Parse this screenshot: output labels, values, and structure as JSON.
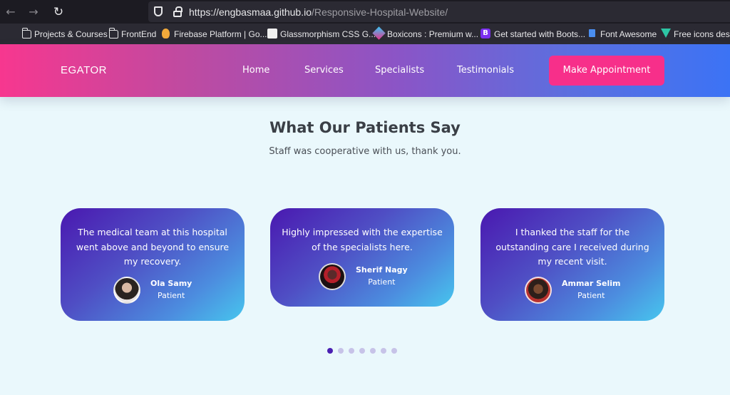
{
  "browser": {
    "url_host": "https://engbasmaa.github.io",
    "url_path": "/Responsive-Hospital-Website/",
    "bookmarks": [
      "Projects & Courses",
      "FrontEnd",
      "Firebase Platform | Go...",
      "Glassmorphism CSS G...",
      "Boxicons : Premium w...",
      "Get started with Boots...",
      "Font Awesome",
      "Free icons desig"
    ]
  },
  "site": {
    "logo": "EGATOR",
    "nav": [
      "Home",
      "Services",
      "Specialists",
      "Testimonials"
    ],
    "cta": "Make Appointment",
    "colors": {
      "cta": "#f72f8a",
      "nav_start": "#f7378f",
      "nav_end": "#3c73f5"
    }
  },
  "section": {
    "title": "What Our Patients Say",
    "subtitle": "Staff was cooperative with us, thank you."
  },
  "testimonials": [
    {
      "quote": "The medical team at this hospital went above and beyond to ensure my recovery.",
      "name": "Ola Samy",
      "role": "Patient"
    },
    {
      "quote": "Highly impressed with the expertise of the specialists here.",
      "name": "Sherif Nagy",
      "role": "Patient"
    },
    {
      "quote": "I thanked the staff for the outstanding care I received during my recent visit.",
      "name": "Ammar Selim",
      "role": "Patient"
    }
  ],
  "carousel": {
    "pages": 7,
    "active": 1
  }
}
